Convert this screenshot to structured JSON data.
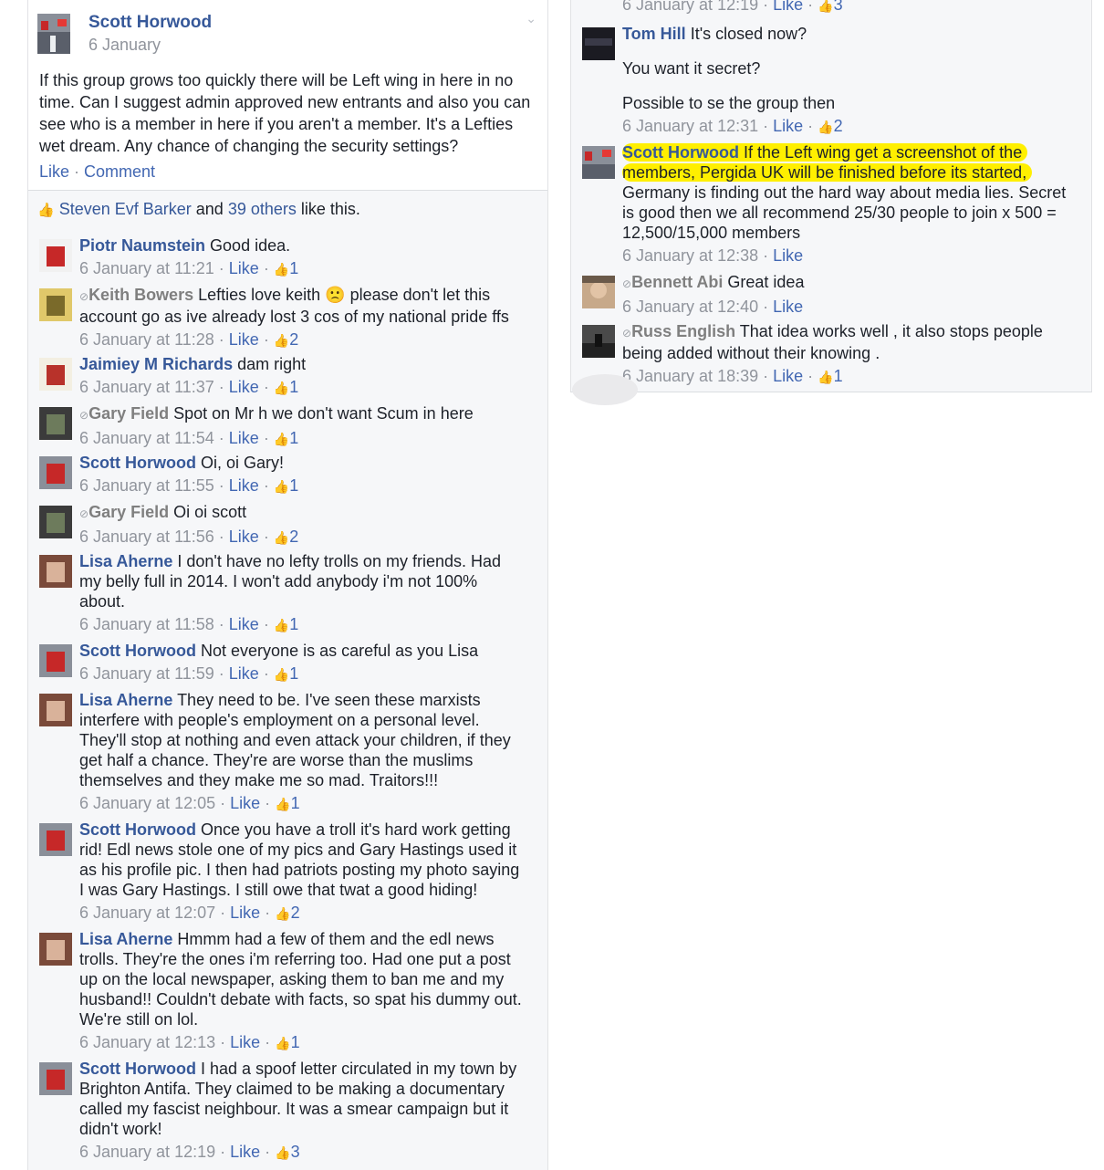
{
  "post": {
    "author": "Scott Horwood",
    "date": "6 January",
    "text": "If this group grows too quickly there will be Left wing in here in no time. Can I suggest admin approved new entrants and also you can see who is a member in here if you aren't a member. It's a Lefties wet dream. Any chance of changing the security settings?",
    "like_label": "Like",
    "separator": " · ",
    "comment_label": "Comment"
  },
  "likes": {
    "first_name": "Steven Evf Barker",
    "and_text": " and ",
    "others": "39 others",
    "suffix": " like this."
  },
  "left_comments": [
    {
      "author": "Piotr Naumstein",
      "text": "Good idea.",
      "time": "6 January at 11:21",
      "like": "Like",
      "count": "1"
    },
    {
      "author": "Keith Bowers",
      "text": "Lefties love keith 🙁 please don't let this account go as ive already lost 3 cos of my national pride ffs",
      "time": "6 January at 11:28",
      "like": "Like",
      "count": "2"
    },
    {
      "author": "Jaimiey M Richards",
      "text": "dam right",
      "time": "6 January at 11:37",
      "like": "Like",
      "count": "1"
    },
    {
      "author": "Gary Field",
      "text": "Spot on Mr h we don't want Scum in here",
      "time": "6 January at 11:54",
      "like": "Like",
      "count": "1"
    },
    {
      "author": "Scott Horwood",
      "text": "Oi, oi Gary!",
      "time": "6 January at 11:55",
      "like": "Like",
      "count": "1"
    },
    {
      "author": "Gary Field",
      "text": "Oi oi scott",
      "time": "6 January at 11:56",
      "like": "Like",
      "count": "2"
    },
    {
      "author": "Lisa Aherne",
      "text": "I don't have no lefty trolls on my friends. Had my belly full in 2014. I won't add anybody i'm not 100% about.",
      "time": "6 January at 11:58",
      "like": "Like",
      "count": "1"
    },
    {
      "author": "Scott Horwood",
      "text": "Not everyone is as careful as you Lisa",
      "time": "6 January at 11:59",
      "like": "Like",
      "count": "1"
    },
    {
      "author": "Lisa Aherne",
      "text": "They need to be. I've seen these marxists interfere with people's employment on a personal level. They'll stop at nothing and even attack your children, if they get half a chance. They're are worse than the muslims themselves and they make me so mad. Traitors!!!",
      "time": "6 January at 12:05",
      "like": "Like",
      "count": "1"
    },
    {
      "author": "Scott Horwood",
      "text": "Once you have a troll it's hard work getting rid! Edl news stole one of my pics and Gary Hastings used it as his profile pic. I then had patriots posting my photo saying I was Gary Hastings. I still owe that twat a good hiding!",
      "time": "6 January at 12:07",
      "like": "Like",
      "count": "2"
    },
    {
      "author": "Lisa Aherne",
      "text": "Hmmm had a few of them and the edl news trolls. They're the ones i'm referring too. Had one put a post up on the local newspaper, asking them to ban me and my husband!! Couldn't debate with facts, so spat his dummy out. We're still on lol.",
      "time": "6 January at 12:13",
      "like": "Like",
      "count": "1"
    },
    {
      "author": "Scott Horwood",
      "text": "I had a spoof letter circulated in my town by Brighton Antifa. They claimed to be making a documentary called my fascist neighbour. It was a smear campaign but it didn't work!",
      "time": "6 January at 12:19",
      "like": "Like",
      "count": "3"
    }
  ],
  "right_top": {
    "time": "6 January at 12:19",
    "like": "Like",
    "count": "3"
  },
  "right_comments": [
    {
      "author": "Tom Hill",
      "text": "It's closed now?",
      "text2": "You want it secret?",
      "text3": "Possible to se the group then",
      "time": "6 January at 12:31",
      "like": "Like",
      "count": "2"
    },
    {
      "author": "Scott Horwood",
      "hl1": "If the Left wing get a screenshot of the",
      "hl2": "members, Pergida UK will be finished before its started,",
      "text": "Germany is finding out the hard way about media lies. Secret is good then we all recommend 25/30 people to join x 500 = 12,500/15,000 members",
      "time": "6 January at 12:38",
      "like": "Like"
    },
    {
      "author": "Bennett Abi",
      "text": "Great idea",
      "time": "6 January at 12:40",
      "like": "Like"
    },
    {
      "author": "Russ English",
      "text": "That idea works well , it also stops people being added without their knowing .",
      "time": "6 January at 18:39",
      "like": "Like",
      "count": "1"
    }
  ],
  "icons": {
    "thumb": "👍",
    "chevron": "⌄",
    "verified_dot": "⊘",
    "sep": " · "
  },
  "colors": {
    "link": "#365899",
    "meta": "#90949c",
    "highlight": "#ffef00",
    "panel": "#f6f7f9"
  }
}
